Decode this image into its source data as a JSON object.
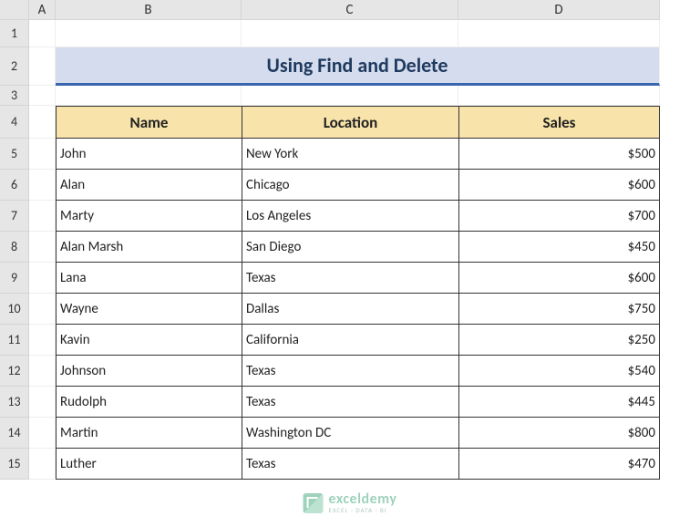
{
  "columns": [
    "A",
    "B",
    "C",
    "D"
  ],
  "rows": [
    "1",
    "2",
    "3",
    "4",
    "5",
    "6",
    "7",
    "8",
    "9",
    "10",
    "11",
    "12",
    "13",
    "14",
    "15"
  ],
  "title": "Using Find and Delete",
  "headers": {
    "name": "Name",
    "location": "Location",
    "sales": "Sales"
  },
  "data": [
    {
      "name": "John",
      "location": "New York",
      "sales": "$500"
    },
    {
      "name": "Alan",
      "location": "Chicago",
      "sales": "$600"
    },
    {
      "name": "Marty",
      "location": "Los Angeles",
      "sales": "$700"
    },
    {
      "name": "Alan Marsh",
      "location": "San Diego",
      "sales": "$450"
    },
    {
      "name": "Lana",
      "location": "Texas",
      "sales": "$600"
    },
    {
      "name": "Wayne",
      "location": "Dallas",
      "sales": "$750"
    },
    {
      "name": "Kavin",
      "location": "California",
      "sales": "$250"
    },
    {
      "name": "Johnson",
      "location": "Texas",
      "sales": "$540"
    },
    {
      "name": "Rudolph",
      "location": "Texas",
      "sales": "$445"
    },
    {
      "name": "Martin",
      "location": "Washington DC",
      "sales": "$800"
    },
    {
      "name": "Luther",
      "location": "Texas",
      "sales": "$470"
    }
  ],
  "watermark": {
    "brand": "exceldemy",
    "tag": "EXCEL · DATA · BI"
  },
  "chart_data": {
    "type": "table",
    "title": "Using Find and Delete",
    "columns": [
      "Name",
      "Location",
      "Sales"
    ],
    "rows": [
      [
        "John",
        "New York",
        500
      ],
      [
        "Alan",
        "Chicago",
        600
      ],
      [
        "Marty",
        "Los Angeles",
        700
      ],
      [
        "Alan Marsh",
        "San Diego",
        450
      ],
      [
        "Lana",
        "Texas",
        600
      ],
      [
        "Wayne",
        "Dallas",
        750
      ],
      [
        "Kavin",
        "California",
        250
      ],
      [
        "Johnson",
        "Texas",
        540
      ],
      [
        "Rudolph",
        "Texas",
        445
      ],
      [
        "Martin",
        "Washington DC",
        800
      ],
      [
        "Luther",
        "Texas",
        470
      ]
    ]
  }
}
